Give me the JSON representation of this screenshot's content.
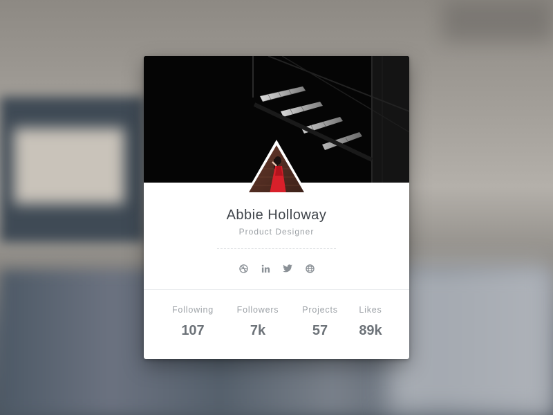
{
  "profile": {
    "name": "Abbie Holloway",
    "role": "Product Designer"
  },
  "socials": [
    {
      "icon": "dribbble-icon"
    },
    {
      "icon": "linkedin-icon"
    },
    {
      "icon": "twitter-icon"
    },
    {
      "icon": "globe-icon"
    }
  ],
  "stats": [
    {
      "label": "Following",
      "value": "107"
    },
    {
      "label": "Followers",
      "value": "7k"
    },
    {
      "label": "Projects",
      "value": "57"
    },
    {
      "label": "Likes",
      "value": "89k"
    }
  ],
  "colors": {
    "card_bg": "#ffffff",
    "cover_bg": "#050505",
    "name_text": "#3f444a",
    "muted_text": "#9ea3a8",
    "stat_value": "#6c7278",
    "icon": "#8a9096",
    "dress_red": "#d8202a"
  }
}
